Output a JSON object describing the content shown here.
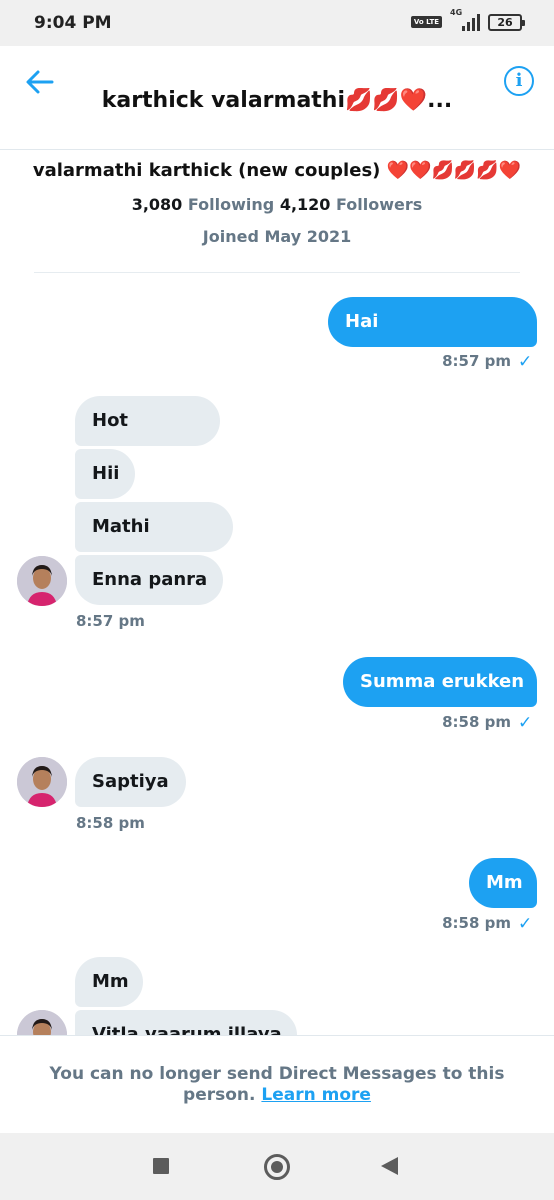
{
  "status_bar": {
    "time": "9:04 PM",
    "volte": "Vo LTE",
    "network": "4G",
    "battery": "26"
  },
  "header": {
    "title": "karthick valarmathi💋💋❤️...",
    "back_icon": "arrow-left-icon",
    "info_icon": "info-icon",
    "accent_color": "#1da1f2"
  },
  "profile": {
    "name": "valarmathi karthick (new couples) ❤️❤️💋💋💋❤️",
    "following_count": "3,080",
    "following_label": "Following",
    "followers_count": "4,120",
    "followers_label": "Followers",
    "joined": "Joined May 2021"
  },
  "messages": [
    {
      "direction": "sent",
      "text": "Hai",
      "time": "8:57 pm",
      "status": "sent"
    },
    {
      "direction": "received",
      "text": "Hot"
    },
    {
      "direction": "received",
      "text": "Hii"
    },
    {
      "direction": "received",
      "text": "Mathi"
    },
    {
      "direction": "received",
      "text": "Enna panra",
      "time": "8:57 pm"
    },
    {
      "direction": "sent",
      "text": "Summa erukken",
      "time": "8:58 pm",
      "status": "sent"
    },
    {
      "direction": "received",
      "text": "Saptiya",
      "time": "8:58 pm"
    },
    {
      "direction": "sent",
      "text": "Mm",
      "time": "8:58 pm",
      "status": "sent"
    },
    {
      "direction": "received",
      "text": "Mm"
    },
    {
      "direction": "received",
      "text": "Vitla vaarum illaya"
    }
  ],
  "colors": {
    "sent_bubble": "#1da1f2",
    "received_bubble": "#e6ecf0",
    "muted_text": "#657786"
  },
  "notice": {
    "text": "You can no longer send Direct Messages to this person.",
    "link": "Learn more"
  },
  "nav": {
    "recents_icon": "square-icon",
    "home_icon": "circle-icon",
    "back_icon": "triangle-back-icon"
  }
}
